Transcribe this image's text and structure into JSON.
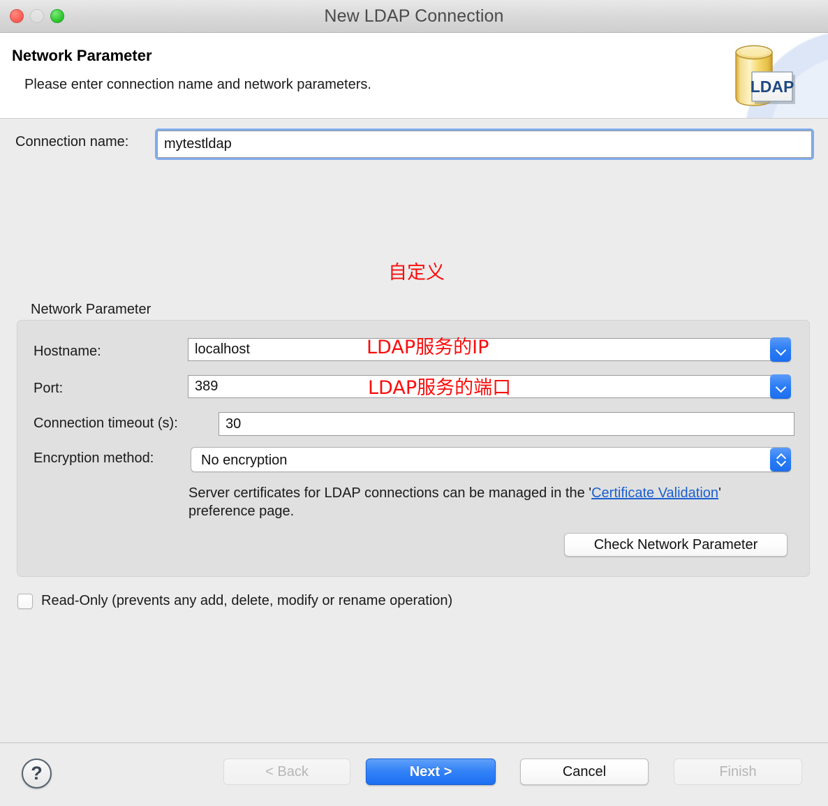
{
  "window": {
    "title": "New LDAP Connection",
    "traffic_lights": [
      "close",
      "minimize",
      "maximize"
    ]
  },
  "header": {
    "title": "Network Parameter",
    "subtitle": "Please enter connection name and network parameters.",
    "icon_label": "LDAP"
  },
  "form": {
    "connection_name_label": "Connection name:",
    "connection_name_value": "mytestldap",
    "group_legend": "Network Parameter",
    "hostname_label": "Hostname:",
    "hostname_value": "localhost",
    "port_label": "Port:",
    "port_value": "389",
    "timeout_label": "Connection timeout (s):",
    "timeout_value": "30",
    "encryption_label": "Encryption method:",
    "encryption_value": "No encryption",
    "cert_note_part1": "Server certificates for LDAP connections can be managed in the '",
    "cert_note_link": "Certificate Validation",
    "cert_note_part2": "' preference page.",
    "check_button": "Check Network Parameter",
    "readonly_label": "Read-Only (prevents any add, delete, modify or rename operation)",
    "readonly_checked": false
  },
  "annotations": [
    {
      "text": "自定义",
      "for": "connection-name"
    },
    {
      "text": "LDAP服务的IP",
      "for": "hostname"
    },
    {
      "text": "LDAP服务的端口",
      "for": "port"
    }
  ],
  "footer": {
    "help": "?",
    "back": "< Back",
    "next": "Next >",
    "cancel": "Cancel",
    "finish": "Finish"
  },
  "colors": {
    "accent_blue": "#2a7cf5",
    "focus_ring": "#82acea",
    "link": "#1a5fd0",
    "annotation_red": "#fb0d0d",
    "window_bg": "#ececec",
    "group_bg": "#e0e0e0"
  }
}
